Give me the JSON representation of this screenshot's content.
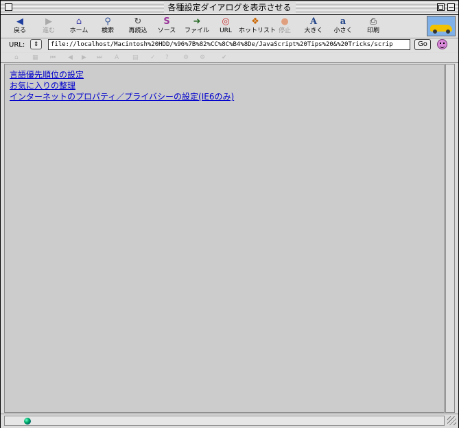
{
  "window": {
    "title": "各種設定ダイアログを表示させる"
  },
  "toolbar": {
    "buttons": [
      {
        "label": "戻る",
        "icon": "back-arrow-icon",
        "glyph": "◀",
        "color": "#1f3f9f"
      },
      {
        "label": "進む",
        "icon": "forward-arrow-icon",
        "glyph": "▶",
        "color": "#a6a6a6"
      },
      {
        "label": "ホーム",
        "icon": "home-icon",
        "glyph": "⌂",
        "color": "#3d3da6"
      },
      {
        "label": "検索",
        "icon": "search-icon",
        "glyph": "⚲",
        "color": "#335599"
      },
      {
        "label": "再読込",
        "icon": "reload-icon",
        "glyph": "↻",
        "color": "#444"
      },
      {
        "label": "ソース",
        "icon": "source-icon",
        "glyph": "S",
        "color": "#993399"
      },
      {
        "label": "ファイル",
        "icon": "file-icon",
        "glyph": "➜",
        "color": "#226622"
      },
      {
        "label": "URL",
        "icon": "url-icon",
        "glyph": "◎",
        "color": "#cc3333"
      },
      {
        "label": "ホットリスト",
        "icon": "hotlist-icon",
        "glyph": "❖",
        "color": "#cc6600"
      },
      {
        "label": "停止",
        "icon": "stop-icon",
        "glyph": "●",
        "color": "#e0a080"
      },
      {
        "label": "大きく",
        "icon": "font-larger-icon",
        "glyph": "A",
        "color": "#224488"
      },
      {
        "label": "小さく",
        "icon": "font-smaller-icon",
        "glyph": "a",
        "color": "#224488"
      },
      {
        "label": "印刷",
        "icon": "print-icon",
        "glyph": "⎙",
        "color": "#333"
      }
    ]
  },
  "address": {
    "label": "URL:",
    "value": "file://localhost/Macintosh%20HDD/%96%7B%82%CC%8C%B4%8De/JavaScript%20Tips%20&%20Tricks/scrip",
    "go_label": "Go"
  },
  "links": [
    {
      "text": "言語優先順位の設定"
    },
    {
      "text": "お気に入りの整理"
    },
    {
      "text": "インターネットのプロパティ／プライバシーの設定(IE6のみ)"
    }
  ]
}
